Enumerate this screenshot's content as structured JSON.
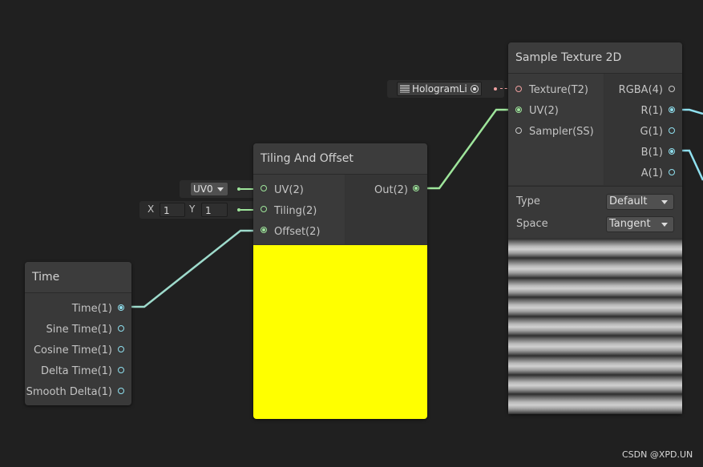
{
  "colors": {
    "background": "#202020",
    "node": "#393939",
    "preview_yellow": "#ffff00",
    "wire_green": "#9ee59b",
    "wire_cyan": "#8fe0ef",
    "port_pink": "#f0a0a0"
  },
  "time_node": {
    "title": "Time",
    "outputs": [
      "Time(1)",
      "Sine Time(1)",
      "Cosine Time(1)",
      "Delta Time(1)",
      "Smooth Delta(1)"
    ]
  },
  "tiling_node": {
    "title": "Tiling And Offset",
    "inputs": [
      "UV(2)",
      "Tiling(2)",
      "Offset(2)"
    ],
    "output": "Out(2)",
    "uv_dropdown": "UV0",
    "tiling_x_label": "X",
    "tiling_x_value": "1",
    "tiling_y_label": "Y",
    "tiling_y_value": "1"
  },
  "sample_node": {
    "title": "Sample Texture 2D",
    "inputs": [
      "Texture(T2)",
      "UV(2)",
      "Sampler(SS)"
    ],
    "outputs": [
      "RGBA(4)",
      "R(1)",
      "G(1)",
      "B(1)",
      "A(1)"
    ],
    "type_label": "Type",
    "type_value": "Default",
    "space_label": "Space",
    "space_value": "Tangent",
    "texture_field": "HologramLi"
  },
  "watermark": "CSDN @XPD.UN",
  "icons": [
    "texture-icon",
    "object-picker-icon",
    "dropdown-arrow-icon"
  ]
}
